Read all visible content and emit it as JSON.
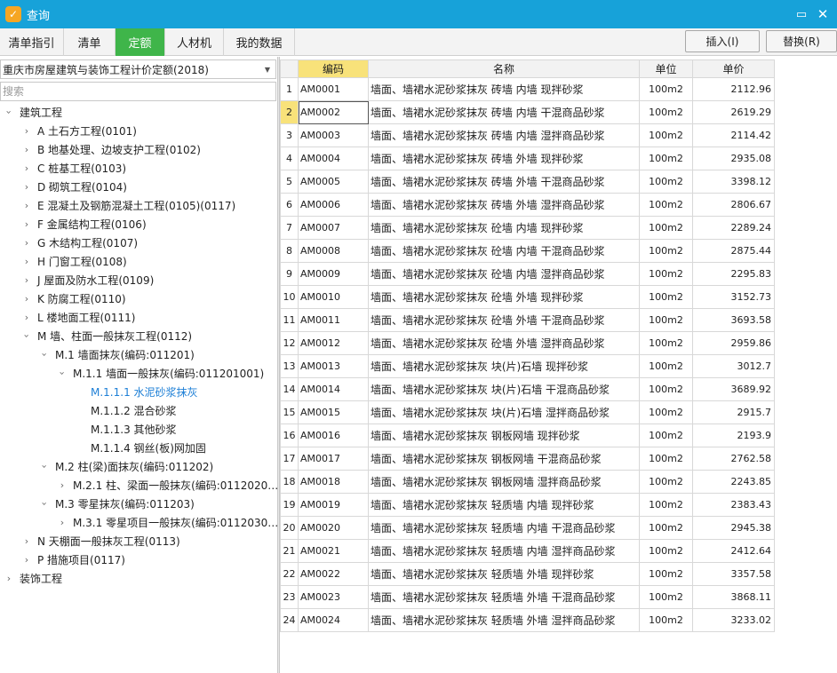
{
  "window": {
    "title": "查询",
    "app_icon": "app-logo-icon",
    "maximize_icon": "maximize-icon",
    "close_icon": "close-icon"
  },
  "tabs": [
    {
      "label": "清单指引",
      "active": false
    },
    {
      "label": "清单",
      "active": false
    },
    {
      "label": "定额",
      "active": true
    },
    {
      "label": "人材机",
      "active": false
    },
    {
      "label": "我的数据",
      "active": false
    }
  ],
  "toolbar": {
    "insert_label": "插入(I)",
    "replace_label": "替换(R)"
  },
  "left": {
    "library": "重庆市房屋建筑与装饰工程计价定额(2018)",
    "search_placeholder": "搜索",
    "tree": [
      {
        "label": "建筑工程",
        "level": 0,
        "state": "open"
      },
      {
        "label": "A 土石方工程(0101)",
        "level": 1,
        "state": "closed"
      },
      {
        "label": "B 地基处理、边坡支护工程(0102)",
        "level": 1,
        "state": "closed"
      },
      {
        "label": "C 桩基工程(0103)",
        "level": 1,
        "state": "closed"
      },
      {
        "label": "D 砌筑工程(0104)",
        "level": 1,
        "state": "closed"
      },
      {
        "label": "E 混凝土及钢筋混凝土工程(0105)(0117)",
        "level": 1,
        "state": "closed"
      },
      {
        "label": "F 金属结构工程(0106)",
        "level": 1,
        "state": "closed"
      },
      {
        "label": "G 木结构工程(0107)",
        "level": 1,
        "state": "closed"
      },
      {
        "label": "H 门窗工程(0108)",
        "level": 1,
        "state": "closed"
      },
      {
        "label": "J 屋面及防水工程(0109)",
        "level": 1,
        "state": "closed"
      },
      {
        "label": "K 防腐工程(0110)",
        "level": 1,
        "state": "closed"
      },
      {
        "label": "L 楼地面工程(0111)",
        "level": 1,
        "state": "closed"
      },
      {
        "label": "M 墙、柱面一般抹灰工程(0112)",
        "level": 1,
        "state": "open"
      },
      {
        "label": "M.1 墙面抹灰(编码:011201)",
        "level": 2,
        "state": "open"
      },
      {
        "label": "M.1.1 墙面一般抹灰(编码:011201001)",
        "level": 3,
        "state": "open"
      },
      {
        "label": "M.1.1.1 水泥砂浆抹灰",
        "level": 4,
        "state": "leaf",
        "selected": true
      },
      {
        "label": "M.1.1.2 混合砂浆",
        "level": 4,
        "state": "leaf"
      },
      {
        "label": "M.1.1.3 其他砂浆",
        "level": 4,
        "state": "leaf"
      },
      {
        "label": "M.1.1.4 钢丝(板)网加固",
        "level": 4,
        "state": "leaf"
      },
      {
        "label": "M.2 柱(梁)面抹灰(编码:011202)",
        "level": 2,
        "state": "open"
      },
      {
        "label": "M.2.1 柱、梁面一般抹灰(编码:0112020…",
        "level": 3,
        "state": "closed"
      },
      {
        "label": "M.3 零星抹灰(编码:011203)",
        "level": 2,
        "state": "open"
      },
      {
        "label": "M.3.1 零星项目一般抹灰(编码:0112030…",
        "level": 3,
        "state": "closed"
      },
      {
        "label": "N 天棚面一般抹灰工程(0113)",
        "level": 1,
        "state": "closed"
      },
      {
        "label": "P 措施项目(0117)",
        "level": 1,
        "state": "closed"
      },
      {
        "label": "装饰工程",
        "level": 0,
        "state": "closed"
      }
    ]
  },
  "grid": {
    "columns": [
      "",
      "编码",
      "名称",
      "单位",
      "单价"
    ],
    "current_row": 2,
    "rows": [
      {
        "no": "1",
        "code": "AM0001",
        "name": "墙面、墙裙水泥砂浆抹灰 砖墙 内墙 现拌砂浆",
        "unit": "100m2",
        "price": "2112.96"
      },
      {
        "no": "2",
        "code": "AM0002",
        "name": "墙面、墙裙水泥砂浆抹灰 砖墙 内墙 干混商品砂浆",
        "unit": "100m2",
        "price": "2619.29"
      },
      {
        "no": "3",
        "code": "AM0003",
        "name": "墙面、墙裙水泥砂浆抹灰 砖墙 内墙 湿拌商品砂浆",
        "unit": "100m2",
        "price": "2114.42"
      },
      {
        "no": "4",
        "code": "AM0004",
        "name": "墙面、墙裙水泥砂浆抹灰 砖墙 外墙 现拌砂浆",
        "unit": "100m2",
        "price": "2935.08"
      },
      {
        "no": "5",
        "code": "AM0005",
        "name": "墙面、墙裙水泥砂浆抹灰 砖墙 外墙 干混商品砂浆",
        "unit": "100m2",
        "price": "3398.12"
      },
      {
        "no": "6",
        "code": "AM0006",
        "name": "墙面、墙裙水泥砂浆抹灰 砖墙 外墙 湿拌商品砂浆",
        "unit": "100m2",
        "price": "2806.67"
      },
      {
        "no": "7",
        "code": "AM0007",
        "name": "墙面、墙裙水泥砂浆抹灰 砼墙 内墙 现拌砂浆",
        "unit": "100m2",
        "price": "2289.24"
      },
      {
        "no": "8",
        "code": "AM0008",
        "name": "墙面、墙裙水泥砂浆抹灰 砼墙 内墙 干混商品砂浆",
        "unit": "100m2",
        "price": "2875.44"
      },
      {
        "no": "9",
        "code": "AM0009",
        "name": "墙面、墙裙水泥砂浆抹灰 砼墙 内墙 湿拌商品砂浆",
        "unit": "100m2",
        "price": "2295.83"
      },
      {
        "no": "10",
        "code": "AM0010",
        "name": "墙面、墙裙水泥砂浆抹灰 砼墙 外墙 现拌砂浆",
        "unit": "100m2",
        "price": "3152.73"
      },
      {
        "no": "11",
        "code": "AM0011",
        "name": "墙面、墙裙水泥砂浆抹灰 砼墙 外墙 干混商品砂浆",
        "unit": "100m2",
        "price": "3693.58"
      },
      {
        "no": "12",
        "code": "AM0012",
        "name": "墙面、墙裙水泥砂浆抹灰 砼墙 外墙 湿拌商品砂浆",
        "unit": "100m2",
        "price": "2959.86"
      },
      {
        "no": "13",
        "code": "AM0013",
        "name": "墙面、墙裙水泥砂浆抹灰 块(片)石墙 现拌砂浆",
        "unit": "100m2",
        "price": "3012.7"
      },
      {
        "no": "14",
        "code": "AM0014",
        "name": "墙面、墙裙水泥砂浆抹灰 块(片)石墙 干混商品砂浆",
        "unit": "100m2",
        "price": "3689.92"
      },
      {
        "no": "15",
        "code": "AM0015",
        "name": "墙面、墙裙水泥砂浆抹灰 块(片)石墙 湿拌商品砂浆",
        "unit": "100m2",
        "price": "2915.7"
      },
      {
        "no": "16",
        "code": "AM0016",
        "name": "墙面、墙裙水泥砂浆抹灰 钢板网墙 现拌砂浆",
        "unit": "100m2",
        "price": "2193.9"
      },
      {
        "no": "17",
        "code": "AM0017",
        "name": "墙面、墙裙水泥砂浆抹灰 钢板网墙 干混商品砂浆",
        "unit": "100m2",
        "price": "2762.58"
      },
      {
        "no": "18",
        "code": "AM0018",
        "name": "墙面、墙裙水泥砂浆抹灰 钢板网墙 湿拌商品砂浆",
        "unit": "100m2",
        "price": "2243.85"
      },
      {
        "no": "19",
        "code": "AM0019",
        "name": "墙面、墙裙水泥砂浆抹灰 轻质墙 内墙 现拌砂浆",
        "unit": "100m2",
        "price": "2383.43"
      },
      {
        "no": "20",
        "code": "AM0020",
        "name": "墙面、墙裙水泥砂浆抹灰 轻质墙 内墙 干混商品砂浆",
        "unit": "100m2",
        "price": "2945.38"
      },
      {
        "no": "21",
        "code": "AM0021",
        "name": "墙面、墙裙水泥砂浆抹灰 轻质墙 内墙 湿拌商品砂浆",
        "unit": "100m2",
        "price": "2412.64"
      },
      {
        "no": "22",
        "code": "AM0022",
        "name": "墙面、墙裙水泥砂浆抹灰 轻质墙 外墙 现拌砂浆",
        "unit": "100m2",
        "price": "3357.58"
      },
      {
        "no": "23",
        "code": "AM0023",
        "name": "墙面、墙裙水泥砂浆抹灰 轻质墙 外墙 干混商品砂浆",
        "unit": "100m2",
        "price": "3868.11"
      },
      {
        "no": "24",
        "code": "AM0024",
        "name": "墙面、墙裙水泥砂浆抹灰 轻质墙 外墙 湿拌商品砂浆",
        "unit": "100m2",
        "price": "3233.02"
      }
    ]
  },
  "colors": {
    "titlebar": "#17a2d9",
    "active_tab": "#3fb54a",
    "header_highlight": "#f8e27a",
    "selected_node": "#1d7fd6"
  }
}
